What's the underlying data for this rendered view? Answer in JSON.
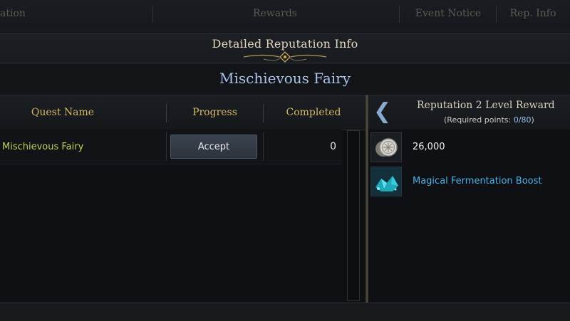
{
  "top_tabs": [
    {
      "label": "ation"
    },
    {
      "label": "Rewards"
    },
    {
      "label": "Event Notice"
    },
    {
      "label": "Rep. Info"
    }
  ],
  "modal": {
    "title": "Detailed Reputation Info",
    "subject": "Mischievous Fairy"
  },
  "quest_table": {
    "headers": [
      "Quest Name",
      "Progress",
      "Completed"
    ],
    "rows": [
      {
        "name": "Mischievous Fairy",
        "action": "Accept",
        "completed": "0"
      }
    ]
  },
  "reward_panel": {
    "title": "Reputation 2 Level Reward",
    "required_label": "(Required points: ",
    "required_value": "0/80",
    "required_suffix": ")",
    "items": [
      {
        "icon": "silver-coin-icon",
        "label": "26,000",
        "color": "#f0f0f0"
      },
      {
        "icon": "crystal-boost-icon",
        "label": "Magical Fermentation Boost",
        "color": "#4fb0e8"
      }
    ]
  },
  "colors": {
    "header_gold": "#d4b76a",
    "subject_blue": "#a9c3ea",
    "quest_green": "#b7d35a",
    "link_blue": "#4fb0e8"
  }
}
